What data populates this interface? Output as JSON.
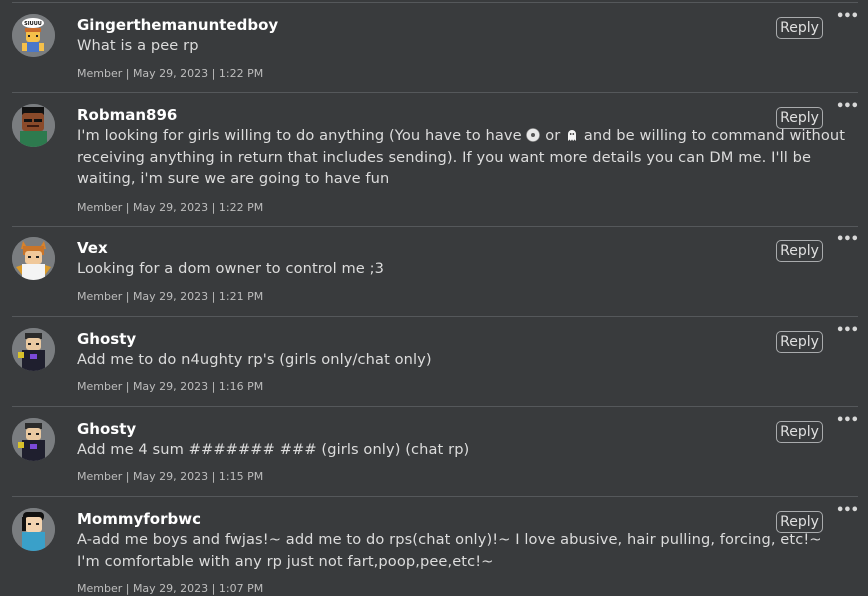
{
  "posts": [
    {
      "username": "Gingerthemanuntedboy",
      "body": "What is a pee rp",
      "meta": "Member | May 29, 2023 | 1:22 PM",
      "avatar": "bald-avatar-with-speech-bubble",
      "avatar_bubble_text": "SIUUU",
      "reply_label": "Reply",
      "more_label": "•••"
    },
    {
      "username": "Robman896",
      "body_parts": [
        "I'm looking for girls willing to do anything (You have to have ",
        " or ",
        " and be willing to command without receiving anything in return that includes sending). If you want more details you can DM me. I'll be waiting, i'm sure we are going to have fun"
      ],
      "emojis": [
        "disc-emoji",
        "ghost-emoji"
      ],
      "meta": "Member | May 29, 2023 | 1:22 PM",
      "avatar": "dark-skin-avatar",
      "reply_label": "Reply",
      "more_label": "•••"
    },
    {
      "username": "Vex",
      "body": "Looking for a dom owner to control me ;3",
      "meta": "Member | May 29, 2023 | 1:21 PM",
      "avatar": "fox-ears-avatar",
      "reply_label": "Reply",
      "more_label": "•••"
    },
    {
      "username": "Ghosty",
      "body": "Add me to do n4ughty rp's (girls only/chat only)",
      "meta": "Member | May 29, 2023 | 1:16 PM",
      "avatar": "dark-outfit-avatar",
      "reply_label": "Reply",
      "more_label": "•••"
    },
    {
      "username": "Ghosty",
      "body": "Add me 4 sum ####### ### (girls only) (chat rp)",
      "meta": "Member | May 29, 2023 | 1:15 PM",
      "avatar": "dark-outfit-avatar",
      "reply_label": "Reply",
      "more_label": "•••"
    },
    {
      "username": "Mommyforbwc",
      "body": "A-add me boys and fwjas!~ add me to do rps(chat only)!~ I love abusive, hair pulling, forcing, etc!~ I'm comfortable with any rp just not fart,poop,pee,etc!~",
      "meta": "Member | May 29, 2023 | 1:07 PM",
      "avatar": "black-hair-avatar",
      "reply_label": "Reply",
      "more_label": "•••"
    }
  ],
  "colors": {
    "background": "#393b3d",
    "separator": "#55585b",
    "username": "#ffffff",
    "body_text": "#dcdcdc",
    "meta_text": "#bdbdbd",
    "button_border": "#a9abad"
  }
}
